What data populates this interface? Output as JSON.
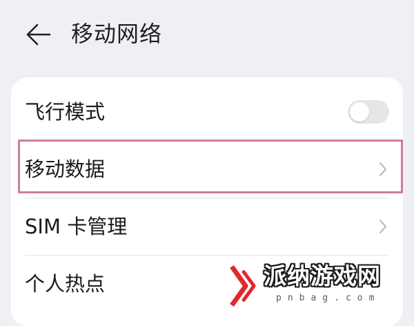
{
  "header": {
    "title": "移动网络",
    "back_icon": "back-arrow-icon"
  },
  "settings": {
    "items": [
      {
        "label": "飞行模式",
        "control": "toggle",
        "toggle_on": false
      },
      {
        "label": "移动数据",
        "control": "chevron",
        "highlighted": true
      },
      {
        "label": "SIM 卡管理",
        "control": "chevron"
      },
      {
        "label": "个人热点",
        "control": "none"
      }
    ]
  },
  "watermark": {
    "text": "派纳游戏网",
    "domain": "pnbag.com"
  },
  "colors": {
    "background": "#eff0f3",
    "card": "#ffffff",
    "highlight_border": "#cc7d98",
    "toggle_off": "#e6e6e8",
    "watermark_accent": "#e0282e"
  }
}
